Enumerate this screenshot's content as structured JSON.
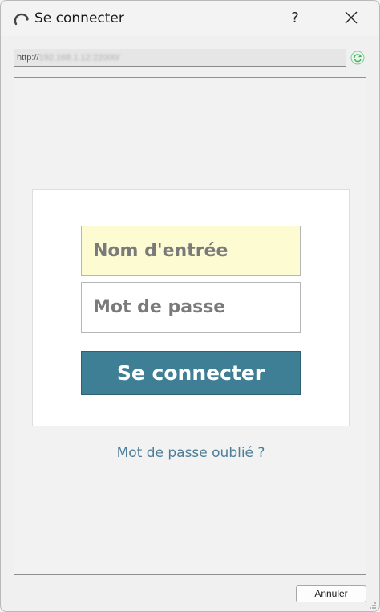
{
  "window": {
    "title": "Se connecter",
    "help_label": "?"
  },
  "urlbar": {
    "prefix": "http://",
    "blurred": "192.168.1.12:22000/"
  },
  "login": {
    "username_placeholder": "Nom d'entrée",
    "password_placeholder": "Mot de passe",
    "submit_label": "Se connecter",
    "forgot_label": "Mot de passe oublié ?"
  },
  "footer": {
    "cancel_label": "Annuler"
  },
  "colors": {
    "accent": "#3f7f96",
    "link": "#4d7d98",
    "username_bg": "#fdfbd2"
  }
}
